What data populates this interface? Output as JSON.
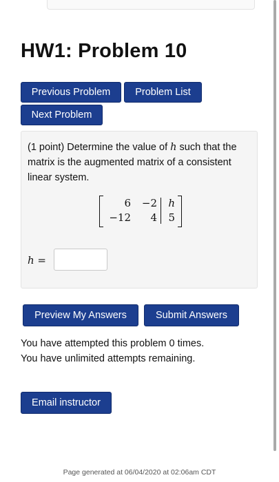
{
  "page": {
    "title": "HW1: Problem 10"
  },
  "nav": {
    "previous_label": "Previous Problem",
    "list_label": "Problem List",
    "next_label": "Next Problem"
  },
  "problem": {
    "points": "(1 point)",
    "text": "Determine the value of",
    "variable": "h",
    "text_after": "such that the matrix is the augmented matrix of a consistent linear system.",
    "matrix": {
      "rows": [
        [
          "6",
          "−2",
          "h"
        ],
        [
          "−12",
          "4",
          "5"
        ]
      ]
    },
    "answer_label": "h =",
    "answer_value": ""
  },
  "actions": {
    "preview_label": "Preview My Answers",
    "submit_label": "Submit Answers"
  },
  "status": {
    "attempts_line": "You have attempted this problem 0 times.",
    "remaining_line": "You have unlimited attempts remaining."
  },
  "contact": {
    "email_label": "Email instructor"
  },
  "footer": {
    "generated": "Page generated at 06/04/2020 at 02:06am CDT"
  },
  "colors": {
    "button_bg": "#1c3e8f",
    "panel_bg": "#f5f5f5"
  }
}
